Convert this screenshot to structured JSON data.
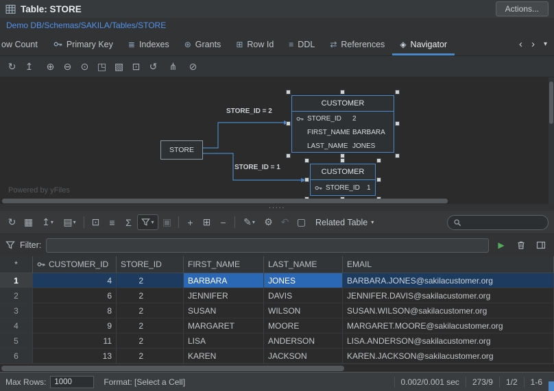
{
  "titlebar": {
    "title": "Table: STORE",
    "actions": "Actions..."
  },
  "breadcrumb": "Demo DB/Schemas/SAKILA/Tables/STORE",
  "tabs": [
    {
      "label": "ow Count",
      "glyph": ""
    },
    {
      "label": "Primary Key",
      "glyph": ""
    },
    {
      "label": "Indexes",
      "glyph": "≣"
    },
    {
      "label": "Grants",
      "glyph": "⊛"
    },
    {
      "label": "Row Id",
      "glyph": "⊞"
    },
    {
      "label": "DDL",
      "glyph": "≡"
    },
    {
      "label": "References",
      "glyph": "⇄"
    },
    {
      "label": "Navigator",
      "glyph": "◈"
    }
  ],
  "tab_nav": {
    "prev": "‹",
    "next": "›",
    "menu": "▾"
  },
  "diagram_toolbar": {
    "refresh": "↻",
    "export": "↥",
    "zoom_in": "⊕",
    "zoom_out": "⊖",
    "zoom_actual": "⊙",
    "fit": "◳",
    "zoom_selection": "▧",
    "open_window": "⊡",
    "relayout": "↺",
    "routing": "⋔",
    "overview": "⊘"
  },
  "diagram": {
    "watermark": "Powered by yFiles",
    "store_node": {
      "label": "STORE"
    },
    "customer_node_selected": {
      "title": "CUSTOMER",
      "attributes": [
        {
          "name": "STORE_ID",
          "value": "2",
          "key": true
        },
        {
          "name": "FIRST_NAME",
          "value": "BARBARA",
          "key": false
        },
        {
          "name": "LAST_NAME",
          "value": "JONES",
          "key": false
        }
      ]
    },
    "customer_node_2": {
      "title": "CUSTOMER",
      "attributes": [
        {
          "name": "STORE_ID",
          "value": "1",
          "key": true
        }
      ]
    },
    "edge_labels": [
      "STORE_ID = 2",
      "STORE_ID = 1"
    ]
  },
  "splitter": "·····",
  "results_toolbar": {
    "icons": {
      "refresh": "↻",
      "grid_mode": "▦",
      "export": "↥",
      "file_menu": "▤",
      "cell_editor": "⊡",
      "row_list": "≡",
      "aggregate": "Σ",
      "save": "▣",
      "add_row": "+",
      "duplicate_row": "⊞",
      "delete_row": "−",
      "edit_menu": "✎",
      "commit_mode": "⚙",
      "undo": "↶",
      "new_script": "▢",
      "caret": "▾"
    },
    "related_table_label": "Related Table",
    "search_value": ""
  },
  "filter": {
    "label": "Filter:",
    "value": "",
    "play": "▶"
  },
  "grid": {
    "corner": "*",
    "columns": [
      "CUSTOMER_ID",
      "STORE_ID",
      "FIRST_NAME",
      "LAST_NAME",
      "EMAIL"
    ],
    "rows": [
      {
        "n": "1",
        "cells": [
          "4",
          "2",
          "BARBARA",
          "JONES",
          "BARBARA.JONES@sakilacustomer.org"
        ]
      },
      {
        "n": "2",
        "cells": [
          "6",
          "2",
          "JENNIFER",
          "DAVIS",
          "JENNIFER.DAVIS@sakilacustomer.org"
        ]
      },
      {
        "n": "3",
        "cells": [
          "8",
          "2",
          "SUSAN",
          "WILSON",
          "SUSAN.WILSON@sakilacustomer.org"
        ]
      },
      {
        "n": "4",
        "cells": [
          "9",
          "2",
          "MARGARET",
          "MOORE",
          "MARGARET.MOORE@sakilacustomer.org"
        ]
      },
      {
        "n": "5",
        "cells": [
          "11",
          "2",
          "LISA",
          "ANDERSON",
          "LISA.ANDERSON@sakilacustomer.org"
        ]
      },
      {
        "n": "6",
        "cells": [
          "13",
          "2",
          "KAREN",
          "JACKSON",
          "KAREN.JACKSON@sakilacustomer.org"
        ]
      }
    ],
    "selection": {
      "row": 1,
      "columns": [
        "FIRST_NAME",
        "LAST_NAME"
      ]
    }
  },
  "statusbar": {
    "max_rows_label": "Max Rows:",
    "max_rows_value": "1000",
    "format": "Format: [Select a Cell]",
    "exec_time": "0.002/0.001 sec",
    "row_col_count": "273/9",
    "page": "1/2",
    "range": "1-6"
  },
  "colors": {
    "accent": "#4A88C7",
    "link": "#5394EC",
    "selected_cell": "#2A67B5",
    "selected_row": "#1D3B5F",
    "play_green": "#55A85C",
    "canvas_bg": "#2B2B2B"
  }
}
